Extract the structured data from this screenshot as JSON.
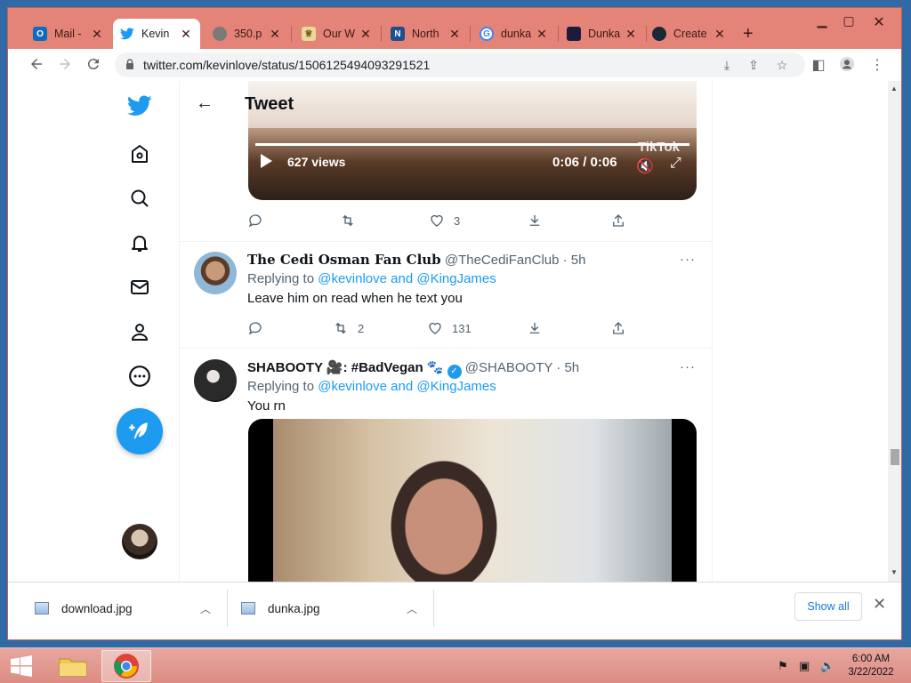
{
  "browser": {
    "tabs": [
      {
        "title": "Mail -",
        "icon": "outlook-icon",
        "color": "#0f6cbd",
        "active": false
      },
      {
        "title": "Kevin",
        "icon": "twitter-icon",
        "color": "#1d9bf0",
        "active": true
      },
      {
        "title": "350.p",
        "icon": "globe-icon",
        "color": "#5f6368",
        "active": false
      },
      {
        "title": "Our W",
        "icon": "book-icon",
        "color": "#c9a227",
        "active": false
      },
      {
        "title": "North",
        "icon": "n-icon",
        "color": "#1f4e8c",
        "active": false
      },
      {
        "title": "dunka",
        "icon": "google-icon",
        "color": "#4285f4",
        "active": false
      },
      {
        "title": "Dunka",
        "icon": "know-your-meme-icon",
        "color": "#1c1b3c",
        "active": false
      },
      {
        "title": "Create",
        "icon": "steam-icon",
        "color": "#1b2838",
        "active": false
      }
    ],
    "url": "twitter.com/kevinlove/status/1506125494093291521"
  },
  "page": {
    "header_title": "Tweet",
    "video1": {
      "views": "627 views",
      "time": "0:06 / 0:06",
      "watermark": "TikTok"
    },
    "tweet1_actions": {
      "likes": "3"
    },
    "tweet2": {
      "name": "The Cedi Osman Fan Club",
      "handle": "@TheCediFanClub",
      "time": "· 5h",
      "replying_prefix": "Replying to ",
      "replying_to": "@kevinlove and @KingJames",
      "text": "Leave him on read when he text you",
      "retweets": "2",
      "likes": "131"
    },
    "tweet3": {
      "name": "SHABOOTY 🎥: #BadVegan 🐾",
      "handle": "@SHABOOTY",
      "time": "· 5h",
      "replying_prefix": "Replying to ",
      "replying_to": "@kevinlove and @KingJames",
      "text": "You rn"
    }
  },
  "downloads": {
    "items": [
      {
        "name": "download.jpg"
      },
      {
        "name": "dunka.jpg"
      }
    ],
    "show_all": "Show all"
  },
  "taskbar": {
    "time": "6:00 AM",
    "date": "3/22/2022"
  },
  "colors": {
    "twitter_blue": "#1d9bf0",
    "chrome_frame": "#e48377",
    "taskbar": "#dc8c82"
  }
}
